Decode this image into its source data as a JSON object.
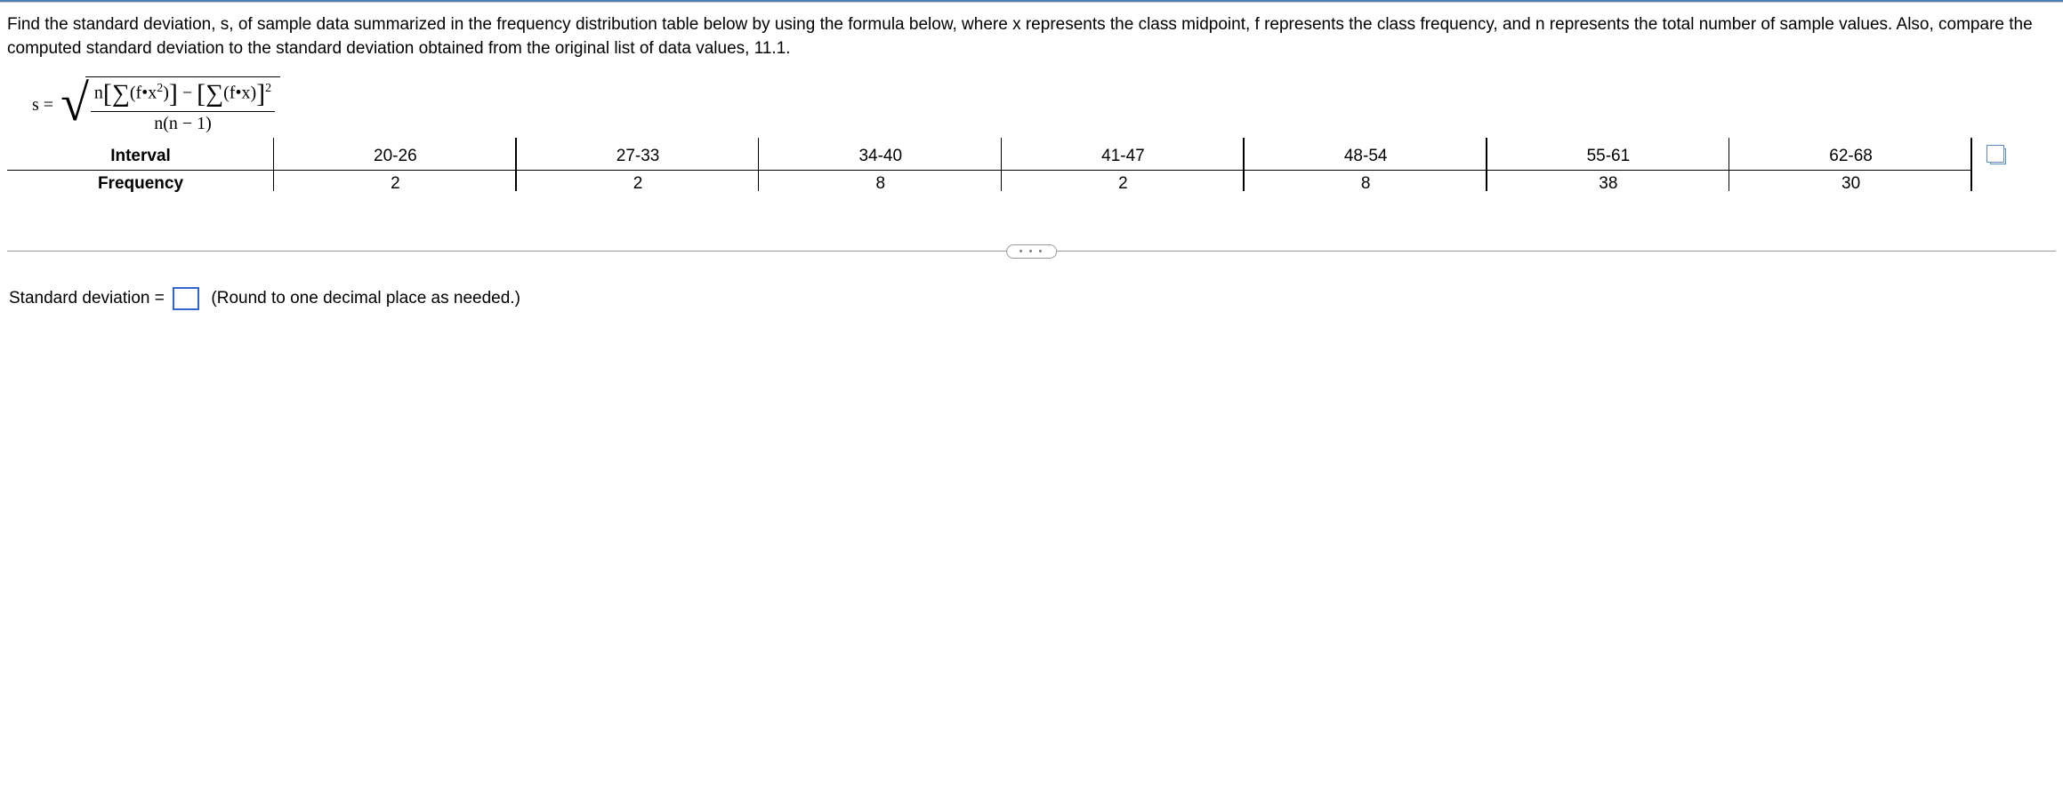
{
  "question": {
    "paragraph": "Find the standard deviation, s, of sample data summarized in the frequency distribution table below by using the formula below, where x represents the class midpoint, f represents the class frequency, and n represents the total number of sample values. Also, compare the computed standard deviation to the standard deviation obtained from the original list of data values, 11.1."
  },
  "formula": {
    "lhs": "s =",
    "numerator": "n[∑(f•x²)] − [∑(f•x)]²",
    "denominator": "n(n − 1)"
  },
  "table": {
    "row_labels": {
      "interval": "Interval",
      "frequency": "Frequency"
    },
    "columns": [
      {
        "interval": "20-26",
        "frequency": "2"
      },
      {
        "interval": "27-33",
        "frequency": "2"
      },
      {
        "interval": "34-40",
        "frequency": "8"
      },
      {
        "interval": "41-47",
        "frequency": "2"
      },
      {
        "interval": "48-54",
        "frequency": "8"
      },
      {
        "interval": "55-61",
        "frequency": "38"
      },
      {
        "interval": "62-68",
        "frequency": "30"
      }
    ]
  },
  "separator": {
    "dots": "• • •"
  },
  "answer": {
    "label": "Standard deviation =",
    "value": "",
    "hint": "(Round to one decimal place as needed.)"
  },
  "icons": {
    "copy": "copy-icon"
  }
}
